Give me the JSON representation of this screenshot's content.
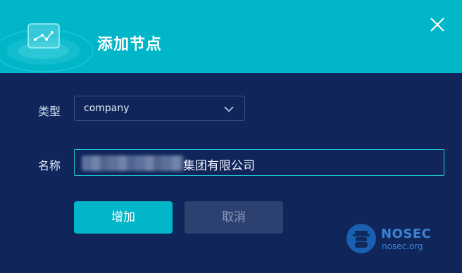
{
  "dialog": {
    "title": "添加节点",
    "close_icon": "close-icon",
    "header_icon": "network-graph-icon"
  },
  "form": {
    "type_label": "类型",
    "type_value": "company",
    "name_label": "名称",
    "name_value": "集团有限公司"
  },
  "buttons": {
    "add_label": "增加",
    "cancel_label": "取消"
  },
  "watermark": {
    "title": "NOSEC",
    "subtitle": "nosec.org"
  },
  "colors": {
    "header": "#00b6c8",
    "body": "#10265a",
    "primary_button": "#00b6c8",
    "secondary_button": "#2d4170"
  }
}
